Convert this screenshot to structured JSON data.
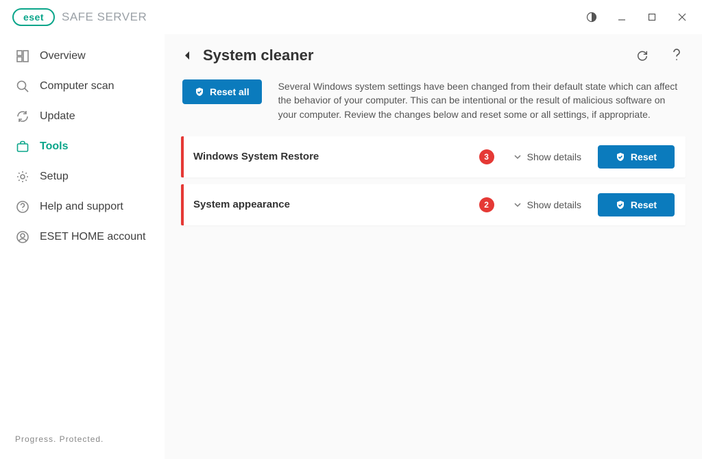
{
  "brand": {
    "logo_text": "eset",
    "product": "SAFE SERVER",
    "tagline": "Progress. Protected."
  },
  "window": {},
  "sidebar": {
    "items": [
      {
        "label": "Overview"
      },
      {
        "label": "Computer scan"
      },
      {
        "label": "Update"
      },
      {
        "label": "Tools"
      },
      {
        "label": "Setup"
      },
      {
        "label": "Help and support"
      },
      {
        "label": "ESET HOME account"
      }
    ]
  },
  "page": {
    "title": "System cleaner",
    "reset_all": "Reset all",
    "intro": "Several Windows system settings have been changed from their default state which can affect the behavior of your computer. This can be intentional or the result of malicious software on your computer. Review the changes below and reset some or all settings, if appropriate."
  },
  "cards": [
    {
      "title": "Windows System Restore",
      "count": "3",
      "show_details": "Show details",
      "reset": "Reset"
    },
    {
      "title": "System appearance",
      "count": "2",
      "show_details": "Show details",
      "reset": "Reset"
    }
  ]
}
